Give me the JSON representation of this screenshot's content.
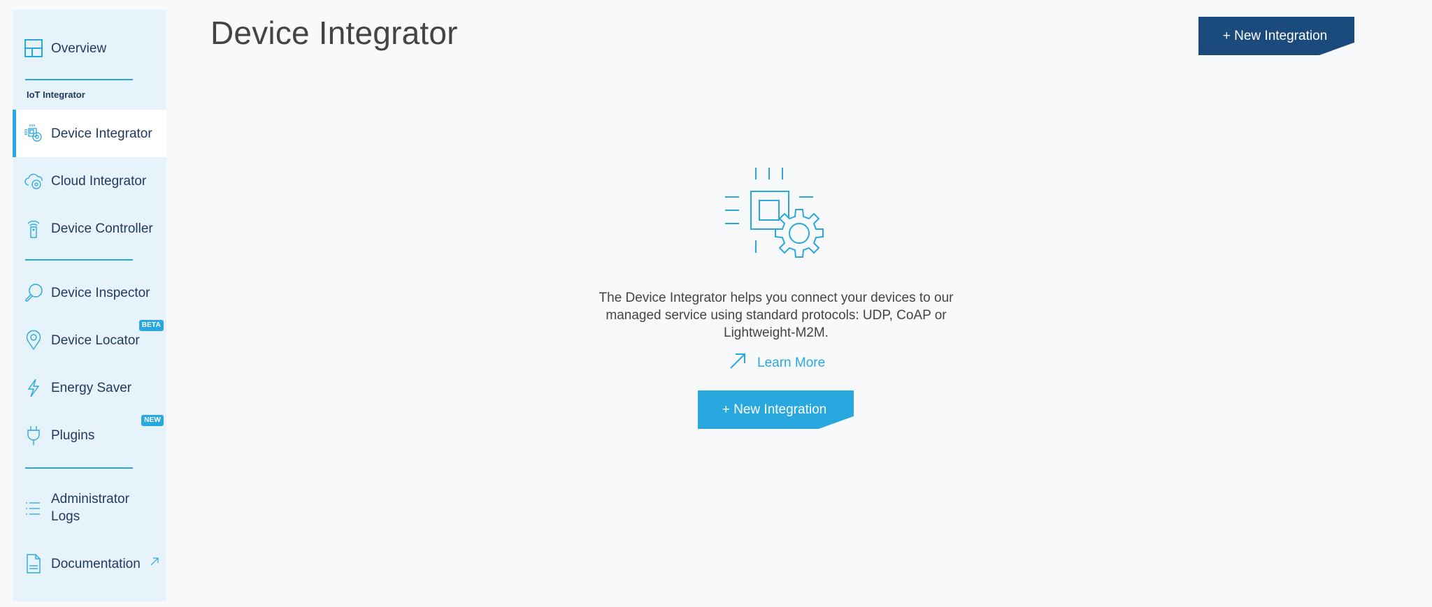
{
  "sidebar": {
    "section_label": "IoT Integrator",
    "items": [
      {
        "id": "overview",
        "label": "Overview",
        "icon": "layout-grid-icon"
      },
      {
        "id": "device-integrator",
        "label": "Device Integrator",
        "icon": "chip-gear-icon",
        "active": true
      },
      {
        "id": "cloud-integrator",
        "label": "Cloud Integrator",
        "icon": "cloud-gear-icon"
      },
      {
        "id": "device-controller",
        "label": "Device Controller",
        "icon": "remote-signal-icon"
      },
      {
        "id": "device-inspector",
        "label": "Device Inspector",
        "icon": "magnifier-icon"
      },
      {
        "id": "device-locator",
        "label": "Device Locator",
        "icon": "location-pin-icon",
        "badge": "BETA"
      },
      {
        "id": "energy-saver",
        "label": "Energy Saver",
        "icon": "lightning-icon"
      },
      {
        "id": "plugins",
        "label": "Plugins",
        "icon": "plug-icon",
        "badge": "NEW"
      },
      {
        "id": "administrator-logs",
        "label_line1": "Administrator",
        "label_line2": "Logs",
        "icon": "list-icon"
      },
      {
        "id": "documentation",
        "label": "Documentation",
        "icon": "document-icon",
        "external": true
      }
    ]
  },
  "header": {
    "title": "Device Integrator",
    "new_integration_label": "+ New Integration"
  },
  "empty_state": {
    "illustration": "chip-gear-illustration",
    "description": "The Device Integrator helps you connect your devices to our managed service using standard protocols: UDP, CoAP or Lightweight-M2M.",
    "learn_more_label": "Learn More",
    "new_integration_label": "+ New Integration"
  },
  "colors": {
    "accent": "#29a8e0",
    "primary_dark": "#1b4b7c",
    "sidebar_bg": "#e6f3fa",
    "page_bg": "#f8f9fa",
    "nav_text": "#233a5e"
  }
}
